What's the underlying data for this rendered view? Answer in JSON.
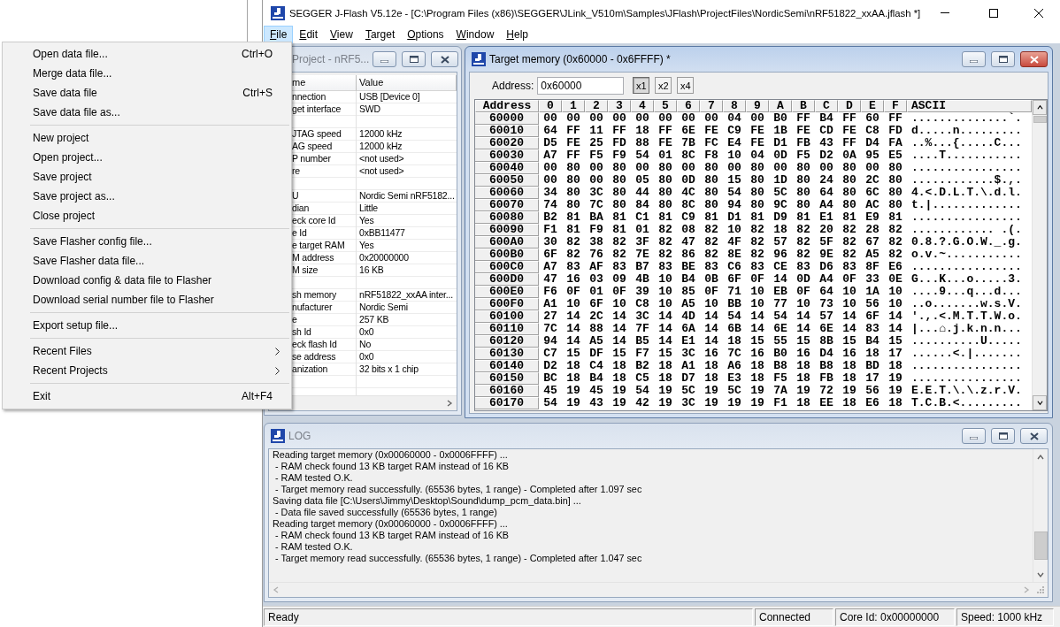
{
  "window": {
    "title": "SEGGER J-Flash V5.12e - [C:\\Program Files (x86)\\SEGGER\\JLink_V510m\\Samples\\JFlash\\ProjectFiles\\NordicSemi\\nRF51822_xxAA.jflash *]"
  },
  "menubar": [
    {
      "label": "File",
      "selected": true
    },
    {
      "label": "Edit",
      "selected": false
    },
    {
      "label": "View",
      "selected": false
    },
    {
      "label": "Target",
      "selected": false
    },
    {
      "label": "Options",
      "selected": false
    },
    {
      "label": "Window",
      "selected": false
    },
    {
      "label": "Help",
      "selected": false
    }
  ],
  "file_menu": {
    "items": [
      {
        "kind": "command",
        "label": "Open data file...",
        "shortcut": "Ctrl+O"
      },
      {
        "kind": "command",
        "label": "Merge data file..."
      },
      {
        "kind": "command",
        "label": "Save data file",
        "shortcut": "Ctrl+S"
      },
      {
        "kind": "command",
        "label": "Save data file as..."
      },
      {
        "kind": "separator"
      },
      {
        "kind": "command",
        "label": "New project"
      },
      {
        "kind": "command",
        "label": "Open project..."
      },
      {
        "kind": "command",
        "label": "Save project"
      },
      {
        "kind": "command",
        "label": "Save project as..."
      },
      {
        "kind": "command",
        "label": "Close project"
      },
      {
        "kind": "separator"
      },
      {
        "kind": "command",
        "label": "Save Flasher config file..."
      },
      {
        "kind": "command",
        "label": "Save Flasher data file..."
      },
      {
        "kind": "command",
        "label": "Download config & data file to Flasher"
      },
      {
        "kind": "command",
        "label": "Download serial number file to Flasher"
      },
      {
        "kind": "separator"
      },
      {
        "kind": "command",
        "label": "Export setup file..."
      },
      {
        "kind": "separator"
      },
      {
        "kind": "submenu",
        "label": "Recent Files"
      },
      {
        "kind": "submenu",
        "label": "Recent Projects"
      },
      {
        "kind": "separator"
      },
      {
        "kind": "command",
        "label": "Exit",
        "shortcut": "Alt+F4"
      }
    ]
  },
  "project_window": {
    "title": "Project - nRF5...",
    "active": false,
    "columns": [
      "me",
      "Value"
    ],
    "rows": [
      {
        "kind": "property",
        "name": "nnection",
        "value": "USB [Device 0]"
      },
      {
        "kind": "property",
        "name": "get interface",
        "value": "SWD"
      },
      {
        "kind": "blank"
      },
      {
        "kind": "property",
        "name": "JTAG speed",
        "value": "12000 kHz"
      },
      {
        "kind": "property",
        "name": "AG speed",
        "value": "12000 kHz"
      },
      {
        "kind": "property",
        "name": "P number",
        "value": "<not used>"
      },
      {
        "kind": "property",
        "name": "re",
        "value": "<not used>"
      },
      {
        "kind": "blank"
      },
      {
        "kind": "property",
        "name": "U",
        "value": "Nordic Semi nRF5182..."
      },
      {
        "kind": "property",
        "name": "dian",
        "value": "Little"
      },
      {
        "kind": "property",
        "name": "eck core Id",
        "value": "Yes"
      },
      {
        "kind": "property",
        "name": "e Id",
        "value": "0xBB11477"
      },
      {
        "kind": "property",
        "name": "e target RAM",
        "value": "Yes"
      },
      {
        "kind": "property",
        "name": "M address",
        "value": "0x20000000"
      },
      {
        "kind": "property",
        "name": "M size",
        "value": "16 KB"
      },
      {
        "kind": "blank"
      },
      {
        "kind": "property",
        "name": "sh memory",
        "value": "nRF51822_xxAA inter..."
      },
      {
        "kind": "property",
        "name": "nufacturer",
        "value": "Nordic Semi"
      },
      {
        "kind": "property",
        "name": "e",
        "value": "257 KB"
      },
      {
        "kind": "property",
        "name": "sh Id",
        "value": "0x0"
      },
      {
        "kind": "property",
        "name": "eck flash Id",
        "value": "No"
      },
      {
        "kind": "property",
        "name": "se address",
        "value": "0x0"
      },
      {
        "kind": "property",
        "name": "anization",
        "value": "32 bits x 1 chip"
      }
    ]
  },
  "memory_window": {
    "title": "Target memory (0x60000 - 0x6FFFF) *",
    "active": true,
    "address_label": "Address:",
    "address_value": "0x60000",
    "zoom_buttons": [
      {
        "label": "x1",
        "selected": true
      },
      {
        "label": "x2",
        "selected": false
      },
      {
        "label": "x4",
        "selected": false
      }
    ],
    "columns": [
      "Address",
      "0",
      "1",
      "2",
      "3",
      "4",
      "5",
      "6",
      "7",
      "8",
      "9",
      "A",
      "B",
      "C",
      "D",
      "E",
      "F",
      "ASCII"
    ],
    "rows": [
      {
        "address": "60000",
        "bytes": [
          "00",
          "00",
          "00",
          "00",
          "00",
          "00",
          "00",
          "00",
          "04",
          "00",
          "B0",
          "FF",
          "B4",
          "FF",
          "60",
          "FF"
        ],
        "ascii": "..............`."
      },
      {
        "address": "60010",
        "bytes": [
          "64",
          "FF",
          "11",
          "FF",
          "18",
          "FF",
          "6E",
          "FE",
          "C9",
          "FE",
          "1B",
          "FE",
          "CD",
          "FE",
          "C8",
          "FD"
        ],
        "ascii": "d.....n........."
      },
      {
        "address": "60020",
        "bytes": [
          "D5",
          "FE",
          "25",
          "FD",
          "88",
          "FE",
          "7B",
          "FC",
          "E4",
          "FE",
          "D1",
          "FB",
          "43",
          "FF",
          "D4",
          "FA"
        ],
        "ascii": "..%...{.....C..."
      },
      {
        "address": "60030",
        "bytes": [
          "A7",
          "FF",
          "F5",
          "F9",
          "54",
          "01",
          "8C",
          "F8",
          "10",
          "04",
          "0D",
          "F5",
          "D2",
          "0A",
          "95",
          "E5"
        ],
        "ascii": "....T..........."
      },
      {
        "address": "60040",
        "bytes": [
          "00",
          "80",
          "00",
          "80",
          "00",
          "80",
          "00",
          "80",
          "00",
          "80",
          "00",
          "80",
          "00",
          "80",
          "00",
          "80"
        ],
        "ascii": "................"
      },
      {
        "address": "60050",
        "bytes": [
          "00",
          "80",
          "00",
          "80",
          "05",
          "80",
          "0D",
          "80",
          "15",
          "80",
          "1D",
          "80",
          "24",
          "80",
          "2C",
          "80"
        ],
        "ascii": "............$.,."
      },
      {
        "address": "60060",
        "bytes": [
          "34",
          "80",
          "3C",
          "80",
          "44",
          "80",
          "4C",
          "80",
          "54",
          "80",
          "5C",
          "80",
          "64",
          "80",
          "6C",
          "80"
        ],
        "ascii": "4.<.D.L.T.\\.d.l."
      },
      {
        "address": "60070",
        "bytes": [
          "74",
          "80",
          "7C",
          "80",
          "84",
          "80",
          "8C",
          "80",
          "94",
          "80",
          "9C",
          "80",
          "A4",
          "80",
          "AC",
          "80"
        ],
        "ascii": "t.|............."
      },
      {
        "address": "60080",
        "bytes": [
          "B2",
          "81",
          "BA",
          "81",
          "C1",
          "81",
          "C9",
          "81",
          "D1",
          "81",
          "D9",
          "81",
          "E1",
          "81",
          "E9",
          "81"
        ],
        "ascii": "................"
      },
      {
        "address": "60090",
        "bytes": [
          "F1",
          "81",
          "F9",
          "81",
          "01",
          "82",
          "08",
          "82",
          "10",
          "82",
          "18",
          "82",
          "20",
          "82",
          "28",
          "82"
        ],
        "ascii": "............ .(."
      },
      {
        "address": "600A0",
        "bytes": [
          "30",
          "82",
          "38",
          "82",
          "3F",
          "82",
          "47",
          "82",
          "4F",
          "82",
          "57",
          "82",
          "5F",
          "82",
          "67",
          "82"
        ],
        "ascii": "0.8.?.G.O.W._.g."
      },
      {
        "address": "600B0",
        "bytes": [
          "6F",
          "82",
          "76",
          "82",
          "7E",
          "82",
          "86",
          "82",
          "8E",
          "82",
          "96",
          "82",
          "9E",
          "82",
          "A5",
          "82"
        ],
        "ascii": "o.v.~..........."
      },
      {
        "address": "600C0",
        "bytes": [
          "A7",
          "83",
          "AF",
          "83",
          "B7",
          "83",
          "BE",
          "83",
          "C6",
          "83",
          "CE",
          "83",
          "D6",
          "83",
          "8F",
          "E6"
        ],
        "ascii": "................"
      },
      {
        "address": "600D0",
        "bytes": [
          "47",
          "16",
          "03",
          "09",
          "4B",
          "10",
          "B4",
          "0B",
          "6F",
          "0F",
          "14",
          "0D",
          "A4",
          "0F",
          "33",
          "0E"
        ],
        "ascii": "G...K...o.....3."
      },
      {
        "address": "600E0",
        "bytes": [
          "F6",
          "0F",
          "01",
          "0F",
          "39",
          "10",
          "85",
          "0F",
          "71",
          "10",
          "EB",
          "0F",
          "64",
          "10",
          "1A",
          "10"
        ],
        "ascii": "....9...q...d..."
      },
      {
        "address": "600F0",
        "bytes": [
          "A1",
          "10",
          "6F",
          "10",
          "C8",
          "10",
          "A5",
          "10",
          "BB",
          "10",
          "77",
          "10",
          "73",
          "10",
          "56",
          "10"
        ],
        "ascii": "..o.......w.s.V."
      },
      {
        "address": "60100",
        "bytes": [
          "27",
          "14",
          "2C",
          "14",
          "3C",
          "14",
          "4D",
          "14",
          "54",
          "14",
          "54",
          "14",
          "57",
          "14",
          "6F",
          "14"
        ],
        "ascii": "'.,.<.M.T.T.W.o."
      },
      {
        "address": "60110",
        "bytes": [
          "7C",
          "14",
          "88",
          "14",
          "7F",
          "14",
          "6A",
          "14",
          "6B",
          "14",
          "6E",
          "14",
          "6E",
          "14",
          "83",
          "14"
        ],
        "ascii": "|...⌂.j.k.n.n..."
      },
      {
        "address": "60120",
        "bytes": [
          "94",
          "14",
          "A5",
          "14",
          "B5",
          "14",
          "E1",
          "14",
          "18",
          "15",
          "55",
          "15",
          "8B",
          "15",
          "B4",
          "15"
        ],
        "ascii": "..........U....."
      },
      {
        "address": "60130",
        "bytes": [
          "C7",
          "15",
          "DF",
          "15",
          "F7",
          "15",
          "3C",
          "16",
          "7C",
          "16",
          "B0",
          "16",
          "D4",
          "16",
          "18",
          "17"
        ],
        "ascii": "......<.|......."
      },
      {
        "address": "60140",
        "bytes": [
          "D2",
          "18",
          "C4",
          "18",
          "B2",
          "18",
          "A1",
          "18",
          "A6",
          "18",
          "B8",
          "18",
          "B8",
          "18",
          "BD",
          "18"
        ],
        "ascii": "................"
      },
      {
        "address": "60150",
        "bytes": [
          "BC",
          "18",
          "B4",
          "18",
          "C5",
          "18",
          "D7",
          "18",
          "E3",
          "18",
          "F5",
          "18",
          "FB",
          "18",
          "17",
          "19"
        ],
        "ascii": "................"
      },
      {
        "address": "60160",
        "bytes": [
          "45",
          "19",
          "45",
          "19",
          "54",
          "19",
          "5C",
          "19",
          "5C",
          "19",
          "7A",
          "19",
          "72",
          "19",
          "56",
          "19"
        ],
        "ascii": "E.E.T.\\.\\.z.r.V."
      },
      {
        "address": "60170",
        "bytes": [
          "54",
          "19",
          "43",
          "19",
          "42",
          "19",
          "3C",
          "19",
          "19",
          "19",
          "F1",
          "18",
          "EE",
          "18",
          "E6",
          "18"
        ],
        "ascii": "T.C.B.<........."
      }
    ]
  },
  "log_window": {
    "title": "LOG",
    "active": false,
    "lines": [
      "Reading target memory (0x00060000 - 0x0006FFFF) ...",
      " - RAM check found 13 KB target RAM instead of 16 KB",
      " - RAM tested O.K.",
      " - Target memory read successfully. (65536 bytes, 1 range) - Completed after 1.097 sec",
      "Saving data file [C:\\Users\\Jimmy\\Desktop\\Sound\\dump_pcm_data.bin] ...",
      " - Data file saved successfully (65536 bytes, 1 range)",
      "Reading target memory (0x00060000 - 0x0006FFFF) ...",
      " - RAM check found 13 KB target RAM instead of 16 KB",
      " - RAM tested O.K.",
      " - Target memory read successfully. (65536 bytes, 1 range) - Completed after 1.047 sec"
    ]
  },
  "status_bar": {
    "message": "Ready",
    "panes": [
      "Connected",
      "Core Id: 0x00000000",
      "Speed: 1000 kHz"
    ]
  }
}
